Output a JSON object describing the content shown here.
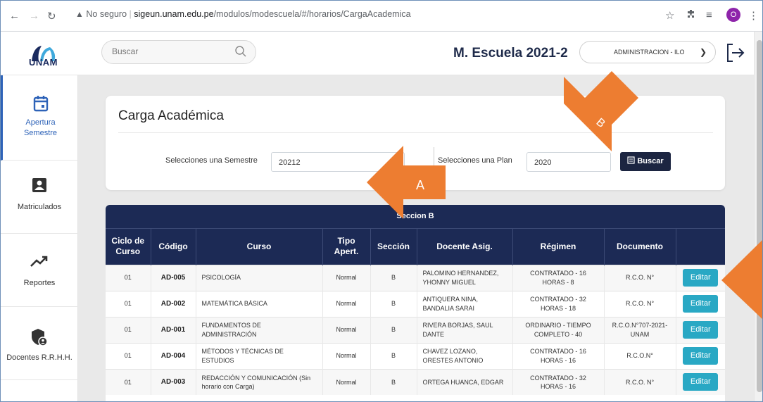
{
  "browser": {
    "security": "No seguro",
    "url_host": "sigeun.unam.edu.pe",
    "url_path": "/modulos/modescuela/#/horarios/CargaAcademica",
    "profile_initial": "O"
  },
  "header": {
    "logo_text": "UNAM",
    "search_placeholder": "Buscar",
    "title": "M. Escuela 2021-2",
    "role_selected": "ADMINISTRACION - ILO"
  },
  "sidebar": {
    "items": [
      {
        "label": "Apertura Semestre",
        "icon": "calendar-icon"
      },
      {
        "label": "Matriculados",
        "icon": "contact-card-icon"
      },
      {
        "label": "Reportes",
        "icon": "trending-up-icon"
      },
      {
        "label": "Docentes R.R.H.H.",
        "icon": "shield-user-icon"
      }
    ]
  },
  "page": {
    "title": "Carga Académica",
    "semester_label": "Selecciones una Semestre",
    "semester_value": "20212",
    "plan_label": "Selecciones una Plan",
    "plan_value": "2020",
    "search_button": "Buscar"
  },
  "table": {
    "caption": "Seccion B",
    "headers": [
      "Ciclo de Curso",
      "Código",
      "Curso",
      "Tipo Apert.",
      "Sección",
      "Docente Asig.",
      "Régimen",
      "Documento",
      ""
    ],
    "edit_label": "Editar",
    "rows": [
      [
        "01",
        "AD-005",
        "PSICOLOGÍA",
        "Normal",
        "B",
        "PALOMINO HERNANDEZ, YHONNY MIGUEL",
        "CONTRATADO - 16 HORAS - 8",
        "R.C.O. N°"
      ],
      [
        "01",
        "AD-002",
        "MATEMÁTICA BÁSICA",
        "Normal",
        "B",
        "ANTIQUERA NINA, BANDALIA SARAI",
        "CONTRATADO - 32 HORAS - 18",
        "R.C.O. N°"
      ],
      [
        "01",
        "AD-001",
        "FUNDAMENTOS DE ADMINISTRACIÓN",
        "Normal",
        "B",
        "RIVERA BORJAS, SAUL DANTE",
        "ORDINARIO - TIEMPO COMPLETO - 40",
        "R.C.O.N°707-2021-UNAM"
      ],
      [
        "01",
        "AD-004",
        "MÉTODOS Y TÉCNICAS DE ESTUDIOS",
        "Normal",
        "B",
        "CHAVEZ LOZANO, ORESTES ANTONIO",
        "CONTRATADO - 16 HORAS - 16",
        "R.C.O.N°"
      ],
      [
        "01",
        "AD-003",
        "REDACCIÓN Y COMUNICACIÓN (Sin horario con Carga)",
        "Normal",
        "B",
        "ORTEGA HUANCA, EDGAR",
        "CONTRATADO - 32 HORAS - 16",
        "R.C.O. N°"
      ]
    ]
  },
  "annotations": {
    "arrow_a_label": "A",
    "arrow_b_label": "B",
    "arrow_color": "#ed7d31"
  }
}
